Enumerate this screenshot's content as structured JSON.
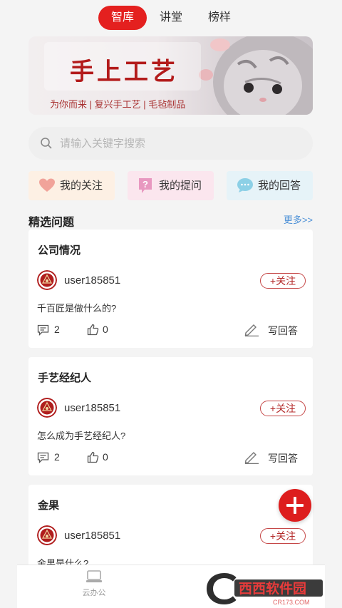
{
  "tabs": [
    {
      "label": "智库",
      "active": true
    },
    {
      "label": "讲堂",
      "active": false
    },
    {
      "label": "榜样",
      "active": false
    }
  ],
  "banner": {
    "title": "手上工艺",
    "subtitle": "为你而来 | 复兴手工艺 | 毛毡制品"
  },
  "search": {
    "placeholder": "请输入关键字搜索"
  },
  "quick_links": [
    {
      "label": "我的关注",
      "icon": "heart-icon"
    },
    {
      "label": "我的提问",
      "icon": "question-icon"
    },
    {
      "label": "我的回答",
      "icon": "chat-bubble-icon"
    }
  ],
  "section": {
    "title": "精选问题",
    "more": "更多>>"
  },
  "questions": [
    {
      "title": "公司情况",
      "user": "user185851",
      "follow": "+关注",
      "text": "千百匠是做什么的?",
      "comments": "2",
      "likes": "0",
      "answer": "写回答"
    },
    {
      "title": "手艺经纪人",
      "user": "user185851",
      "follow": "+关注",
      "text": "怎么成为手艺经纪人?",
      "comments": "2",
      "likes": "0",
      "answer": "写回答"
    },
    {
      "title": "金果",
      "user": "user185851",
      "follow": "+关注",
      "text": "金果是什么?"
    }
  ],
  "bottom_nav": [
    {
      "label": "云办公",
      "icon": "laptop-icon"
    }
  ],
  "watermark": {
    "text": "西西软件园",
    "sub": "CR173.COM"
  },
  "colors": {
    "accent": "#e4201f",
    "link": "#4a8fd6"
  }
}
